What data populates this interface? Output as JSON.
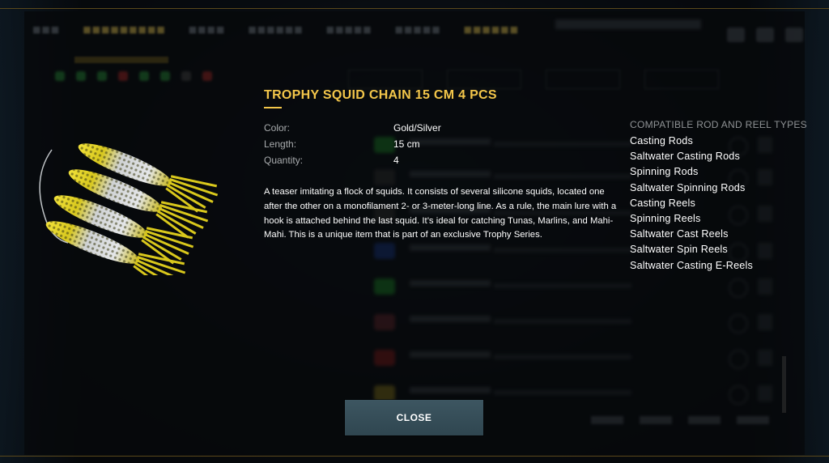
{
  "item": {
    "title": "TROPHY SQUID CHAIN 15 CM 4 PCS",
    "properties": [
      {
        "label": "Color:",
        "value": "Gold/Silver"
      },
      {
        "label": "Length:",
        "value": "15 cm"
      },
      {
        "label": "Quantity:",
        "value": "4"
      }
    ],
    "description": "A teaser imitating a flock of squids. It consists of several silicone squids, located one after the other on a monofilament 2- or 3-meter-long line. As a rule, the main lure with a hook is attached behind the last squid. It’s ideal for catching Tunas, Marlins, and Mahi-Mahi. This is a unique item that is part of an exclusive Trophy Series.",
    "image_icon": "squid-chain-lure-icon"
  },
  "compatible": {
    "heading": "COMPATIBLE ROD AND REEL TYPES",
    "items": [
      "Casting Rods",
      "Saltwater Casting Rods",
      "Spinning Rods",
      "Saltwater Spinning Rods",
      "Casting Reels",
      "Spinning Reels",
      "Saltwater Cast Reels",
      "Saltwater Spin Reels",
      "Saltwater Casting E-Reels"
    ]
  },
  "actions": {
    "close_label": "CLOSE"
  },
  "colors": {
    "accent": "#f3c64a",
    "button": "#355059"
  }
}
